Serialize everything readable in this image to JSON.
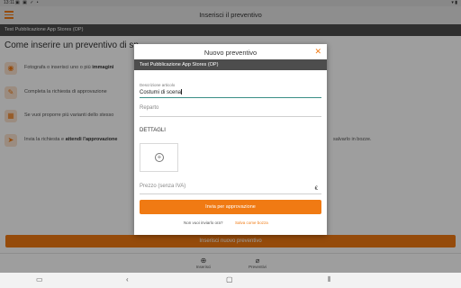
{
  "status_bar": {
    "time": "13:11",
    "left_icons": "▣ ▣ ✓ •",
    "right_icons": "▾ ▮"
  },
  "app_bar": {
    "title": "Inserisci il preventivo",
    "menu_icon": "hamburger-icon"
  },
  "subheader": {
    "title": "Test Pubblicazione App Stores (OP)"
  },
  "content": {
    "title": "Come inserire un preventivo di sp",
    "steps": [
      {
        "icon": "camera-icon",
        "text_a": "Fotografa o inserisci uno o più ",
        "text_b": "immagini",
        "tail": ""
      },
      {
        "icon": "edit-icon",
        "text_a": "Completa la richiesta di approvazione ",
        "text_b": "",
        "tail": ""
      },
      {
        "icon": "grid-icon",
        "text_a": "Se vuoi proporre più varianti dello stesso",
        "text_b": "",
        "tail": ""
      },
      {
        "icon": "send-icon",
        "text_a": "Invia la richiesta e ",
        "text_b": "attendi l'approvazione",
        "tail": "salvarlo in bozze."
      }
    ],
    "primary_button": "Inserisci nuovo preventivo"
  },
  "tabs": [
    {
      "icon": "plus-circle",
      "label": "Inserisci"
    },
    {
      "icon": "paperclip",
      "label": "Preventivi"
    }
  ],
  "nav": {
    "left": "▭",
    "back": "‹",
    "home": "▢",
    "recents": "⦀"
  },
  "dialog": {
    "title": "Nuovo preventivo",
    "close": "✕",
    "subtitle": "Test Pubblicazione App Stores (OP)",
    "description_label": "Descrizione articolo",
    "description_value": "Costumi di scena",
    "department_placeholder": "Reparto",
    "details_label": "DETTAGLI",
    "add_symbol": "+",
    "price_placeholder": "Prezzo (senza IVA)",
    "currency": "€",
    "submit_label": "Invia per approvazione",
    "footer_question": "Non vuoi inviarlo ora?",
    "footer_link": "Salva come bozza"
  },
  "colors": {
    "accent": "#f07a13",
    "header_dark": "#4d4d4d",
    "focus": "#3a8f86"
  }
}
